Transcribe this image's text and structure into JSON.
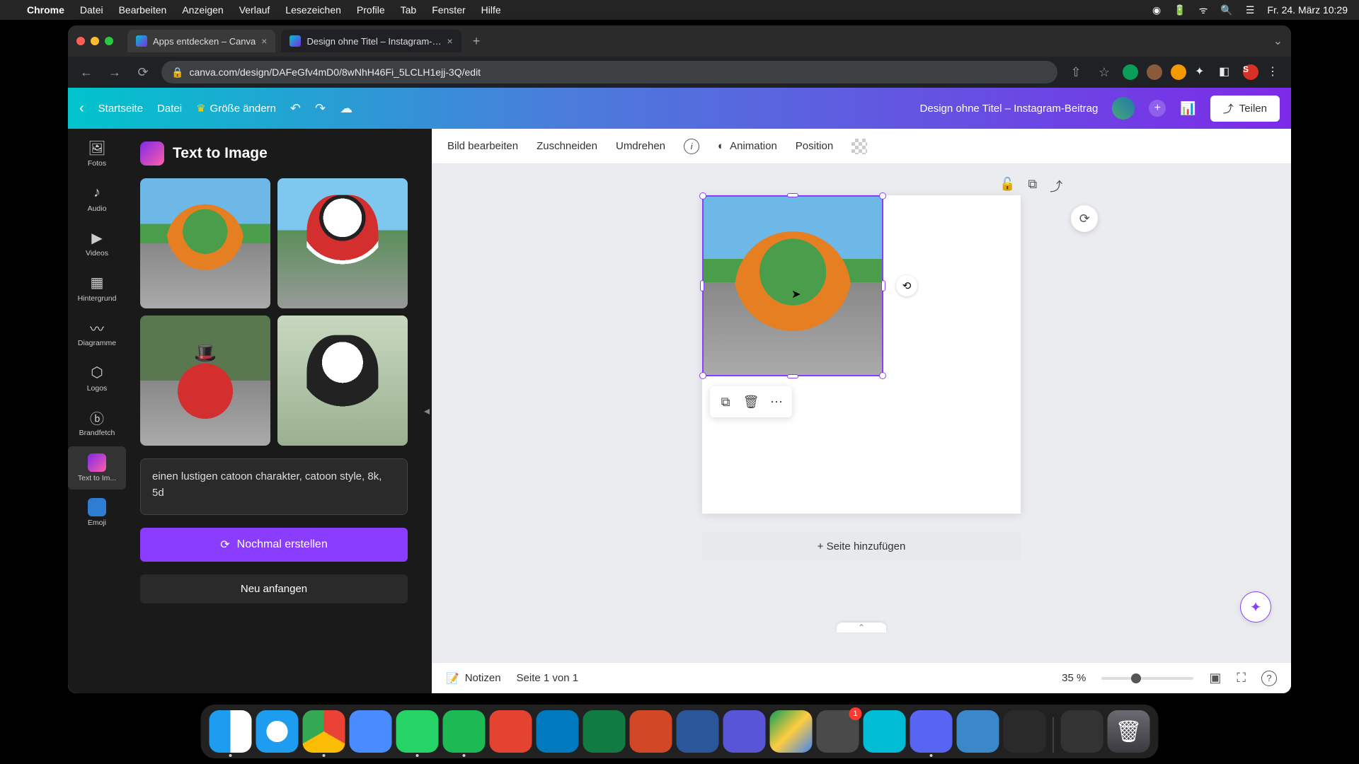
{
  "menubar": {
    "app": "Chrome",
    "items": [
      "Datei",
      "Bearbeiten",
      "Anzeigen",
      "Verlauf",
      "Lesezeichen",
      "Profile",
      "Tab",
      "Fenster",
      "Hilfe"
    ],
    "clock": "Fr. 24. März  10:29"
  },
  "tabs": {
    "t1": "Apps entdecken – Canva",
    "t2": "Design ohne Titel – Instagram-…"
  },
  "url": "canva.com/design/DAFeGfv4mD0/8wNhH46Fi_5LCLH1ejj-3Q/edit",
  "avatar_letter": "S",
  "canva_header": {
    "home": "Startseite",
    "file": "Datei",
    "resize": "Größe ändern",
    "title": "Design ohne Titel – Instagram-Beitrag",
    "share": "Teilen"
  },
  "rail": {
    "fotos": "Fotos",
    "audio": "Audio",
    "videos": "Videos",
    "hintergrund": "Hintergrund",
    "diagramme": "Diagramme",
    "logos": "Logos",
    "brandfetch": "Brandfetch",
    "t2i": "Text to Im...",
    "emoji": "Emoji"
  },
  "panel": {
    "title": "Text to Image",
    "prompt": "einen lustigen catoon charakter, catoon style, 8k, 5d",
    "regenerate": "Nochmal erstellen",
    "restart": "Neu anfangen"
  },
  "context": {
    "edit": "Bild bearbeiten",
    "crop": "Zuschneiden",
    "flip": "Umdrehen",
    "animation": "Animation",
    "position": "Position"
  },
  "add_page": "+ Seite hinzufügen",
  "bottom": {
    "notes": "Notizen",
    "page": "Seite 1 von 1",
    "zoom": "35 %"
  },
  "dock_badge": "1"
}
